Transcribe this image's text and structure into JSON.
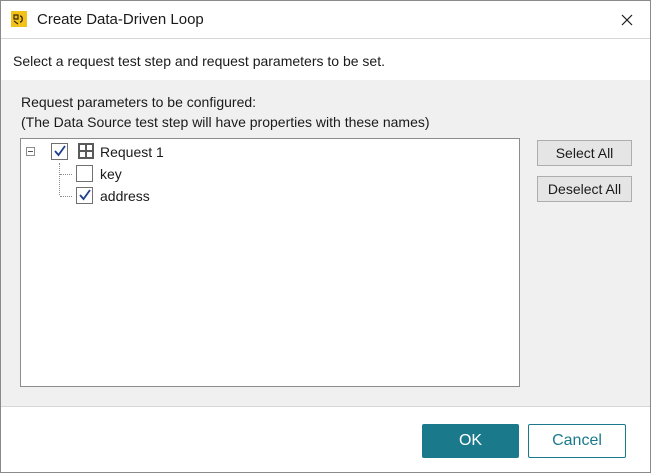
{
  "window": {
    "title": "Create Data-Driven Loop",
    "icon": "soapui-app-icon",
    "close_icon": "close-icon"
  },
  "header": {
    "instruction": "Select a request test step and request parameters to be set."
  },
  "content": {
    "label_line1": "Request parameters to be configured:",
    "label_line2": "(The Data Source test step will have properties with these names)",
    "tree": {
      "root": {
        "label": "Request 1",
        "checked": true,
        "expanded": true,
        "icon": "rest-request-icon"
      },
      "children": [
        {
          "label": "key",
          "checked": false
        },
        {
          "label": "address",
          "checked": true
        }
      ]
    },
    "select_all_label": "Select All",
    "deselect_all_label": "Deselect All"
  },
  "footer": {
    "ok_label": "OK",
    "cancel_label": "Cancel"
  },
  "colors": {
    "accent": "#1a7a8c",
    "check": "#1f3f8f"
  }
}
